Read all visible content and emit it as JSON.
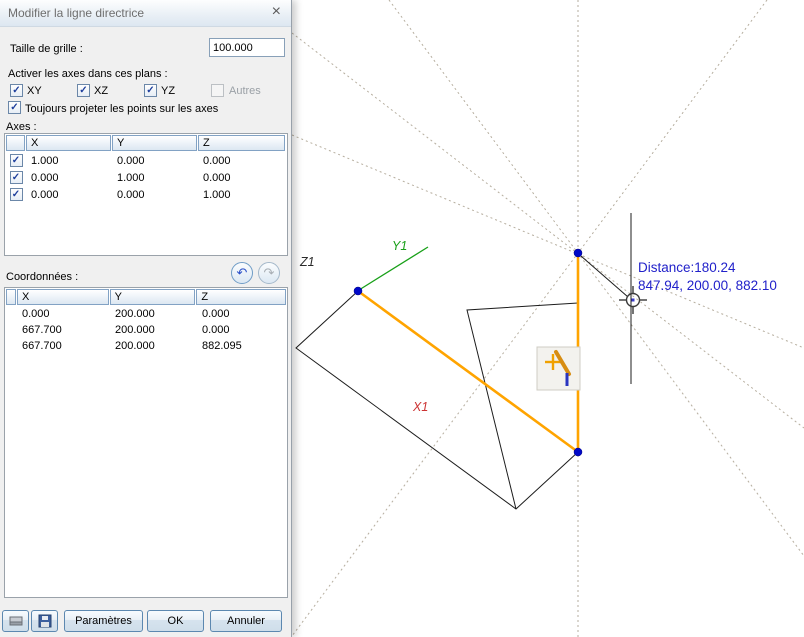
{
  "window": {
    "title": "Modifier la ligne directrice"
  },
  "icons": {
    "close": "×",
    "check": "✓",
    "undo": "↶",
    "redo": "↷"
  },
  "dialog": {
    "grid_size": {
      "label": "Taille de grille :",
      "value": "100.000"
    },
    "planes": {
      "label": "Activer les axes dans ces plans :",
      "options": [
        {
          "label": "XY",
          "checked": true
        },
        {
          "label": "XZ",
          "checked": true
        },
        {
          "label": "YZ",
          "checked": true
        },
        {
          "label": "Autres",
          "checked": false,
          "enabled": false
        }
      ]
    },
    "project_points": {
      "label": "Toujours projeter les points sur les axes",
      "checked": true
    },
    "axes": {
      "label": "Axes :",
      "headers": [
        "X",
        "Y",
        "Z"
      ],
      "rows": [
        {
          "checked": true,
          "x": "1.000",
          "y": "0.000",
          "z": "0.000"
        },
        {
          "checked": true,
          "x": "0.000",
          "y": "1.000",
          "z": "0.000"
        },
        {
          "checked": true,
          "x": "0.000",
          "y": "0.000",
          "z": "1.000"
        }
      ]
    },
    "coordinates": {
      "label": "Coordonnées :",
      "headers": [
        "X",
        "Y",
        "Z"
      ],
      "rows": [
        {
          "x": "0.000",
          "y": "200.000",
          "z": "0.000"
        },
        {
          "x": "667.700",
          "y": "200.000",
          "z": "0.000"
        },
        {
          "x": "667.700",
          "y": "200.000",
          "z": "882.095"
        }
      ]
    },
    "buttons": {
      "parametres": "Paramètres",
      "ok": "OK",
      "annuler": "Annuler"
    }
  },
  "viewport": {
    "axis_labels": {
      "y1": "Y1",
      "z1": "Z1",
      "x1": "X1"
    },
    "tooltip": {
      "line1": "Distance:180.24",
      "line2": "847.94, 200.00, 882.10"
    },
    "colors": {
      "guideline": "#ffa400",
      "points": "#0008c8",
      "y_axis": "#18a018",
      "x_label": "#cc3333",
      "z_label": "#2a2a2a",
      "tooltip_text": "#2121ca",
      "construction_lines": "#b6ae9f"
    }
  }
}
